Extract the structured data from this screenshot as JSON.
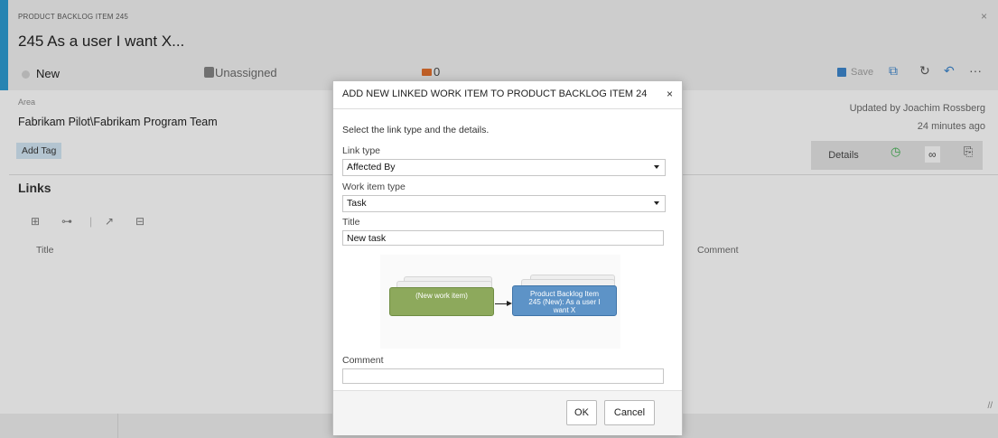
{
  "work_item": {
    "kind": "PRODUCT BACKLOG ITEM 245",
    "title": "245  As a user I want X...",
    "close": "×",
    "state": "New",
    "assigned": "Unassigned",
    "discussion_count": "0",
    "save_label": "Save",
    "more": "···",
    "area_label": "Area",
    "area_value": "Fabrikam Pilot\\Fabrikam Program Team",
    "add_tag": "Add Tag",
    "updated_line1": "Updated by Joachim Rossberg",
    "updated_line2": "24 minutes ago",
    "colors": {
      "accent": "#2b93c7",
      "tag_bg": "#c8dbe8",
      "discussion": "#d56a2c"
    }
  },
  "tabs": {
    "details": "Details"
  },
  "links": {
    "heading": "Links",
    "col_title": "Title",
    "col_comment": "Comment"
  },
  "dialog": {
    "title": "ADD NEW LINKED WORK ITEM TO PRODUCT BACKLOG ITEM 24",
    "close": "×",
    "intro": "Select the link type and the details.",
    "link_type_label": "Link type",
    "link_type_value": "Affected By",
    "work_item_type_label": "Work item type",
    "work_item_type_value": "Task",
    "title_label": "Title",
    "title_value": "New task",
    "diagram_new": "(New work item)",
    "diagram_target_1": "Product Backlog Item",
    "diagram_target_2": "245 (New): As a user I",
    "diagram_target_3": "want X",
    "comment_label": "Comment",
    "comment_value": "",
    "ok": "OK",
    "cancel": "Cancel"
  }
}
